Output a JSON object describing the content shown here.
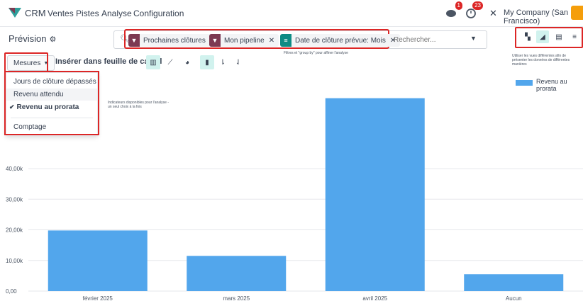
{
  "navbar": {
    "app_name": "CRM",
    "menu": [
      "Ventes",
      "Pistes",
      "Analyse",
      "Configuration"
    ],
    "company": "My Company (San Francisco)",
    "badges": {
      "chat": "1",
      "activities": "23"
    }
  },
  "control": {
    "page_title": "Prévision",
    "facets": [
      {
        "label": "Prochaines clôtures",
        "icon": "filter-icon",
        "color": "#7c3a52"
      },
      {
        "label": "Mon pipeline",
        "icon": "filter-icon",
        "color": "#7c3a52"
      },
      {
        "label": "Date de clôture prévue: Mois",
        "icon": "group-by-icon",
        "color": "#0e8b84"
      }
    ],
    "search_placeholder": "Rechercher...",
    "views": [
      "pivot-view-icon",
      "graph-view-icon",
      "list-view-icon",
      "kanban-view-icon"
    ]
  },
  "toolbar": {
    "mesures_label": "Mesures",
    "insert_label": "Insérer dans feuille de calcul",
    "annotation_filters": "Filtres et \"group by\" pour affiner l'analyse",
    "annotation_indicators": "Indicateurs disponibles pour l'analyse - un seul choix à la fois",
    "annotation_views": "Utiliser les vues différentes afin de présenter les données de différentes manières"
  },
  "mesures_menu": {
    "items": [
      {
        "label": "Jours de clôture dépassés",
        "checked": false
      },
      {
        "label": "Revenu attendu",
        "checked": false
      },
      {
        "label": "Revenu au prorata",
        "checked": true
      },
      {
        "label": "Comptage",
        "checked": false
      }
    ]
  },
  "chart_data": {
    "type": "bar",
    "categories": [
      "février 2025",
      "mars 2025",
      "avril 2025",
      "Aucun"
    ],
    "series": [
      {
        "name": "Revenu au prorata",
        "values": [
          19800,
          11500,
          63000,
          5500
        ]
      }
    ],
    "ylim": [
      0,
      65000
    ],
    "yticks": [
      "0,00",
      "10,00k",
      "20,00k",
      "30,00k",
      "40,00k"
    ],
    "color": "#52a6ec",
    "grid": true,
    "legend": "top-right"
  }
}
